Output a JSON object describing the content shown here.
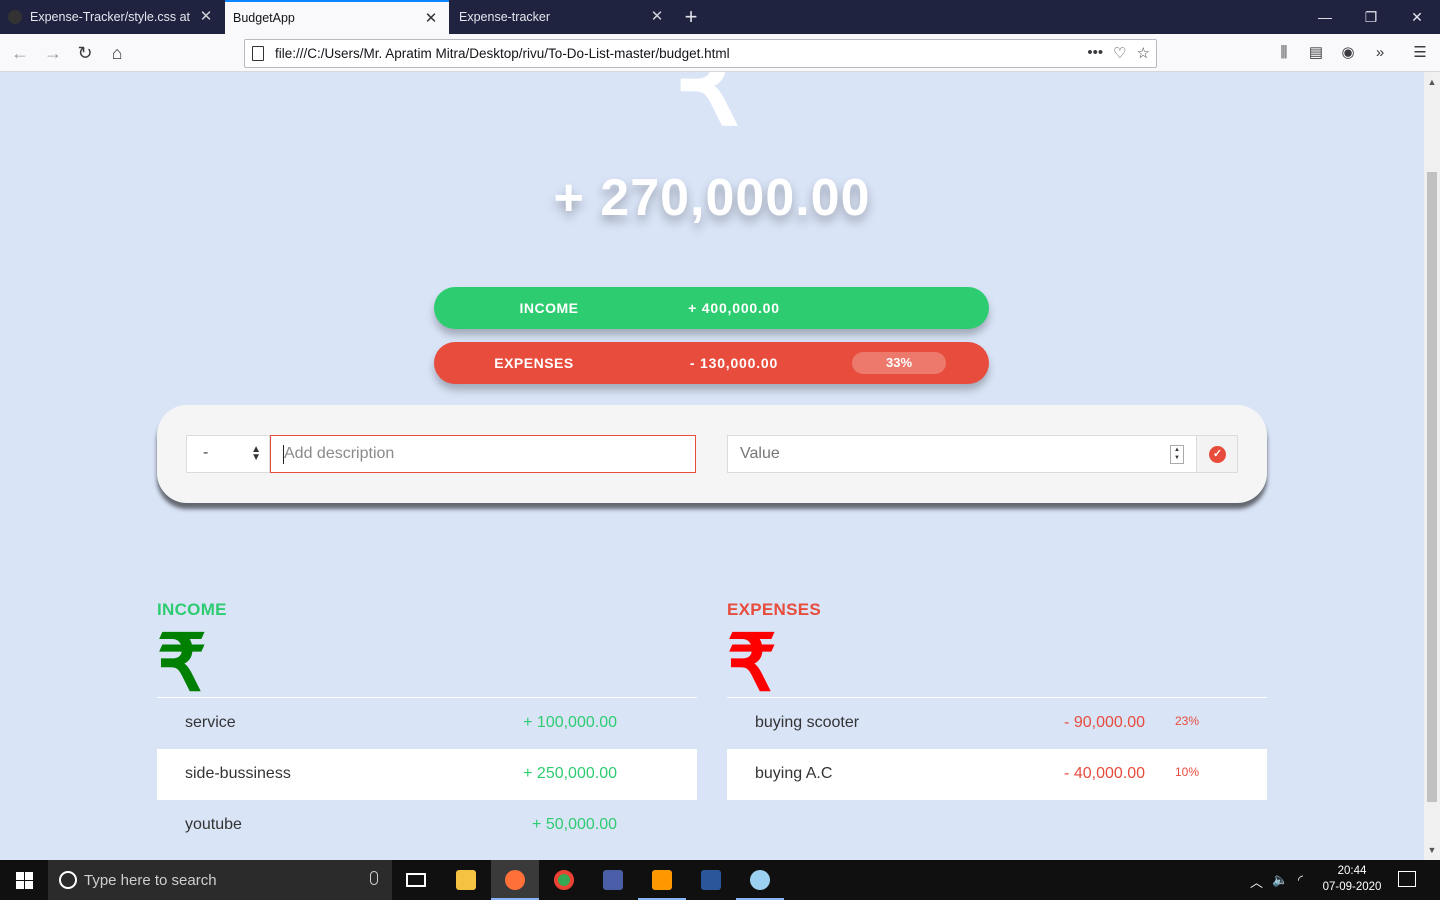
{
  "browser": {
    "tabs": [
      {
        "label": "Expense-Tracker/style.css at master",
        "active": false
      },
      {
        "label": "BudgetApp",
        "active": true
      },
      {
        "label": "Expense-tracker",
        "active": false
      }
    ],
    "url": "file:///C:/Users/Mr. Apratim Mitra/Desktop/rivu/To-Do-List-master/budget.html"
  },
  "budget": {
    "available": "+ 270,000.00",
    "income_label": "INCOME",
    "income_value": "+ 400,000.00",
    "expenses_label": "EXPENSES",
    "expenses_value": "- 130,000.00",
    "expenses_percentage": "33%"
  },
  "add_form": {
    "type_value": "-",
    "description_placeholder": "Add description",
    "value_placeholder": "Value"
  },
  "income": {
    "title": "INCOME",
    "symbol": "₹",
    "items": [
      {
        "description": "service",
        "value": "+ 100,000.00"
      },
      {
        "description": "side-bussiness",
        "value": "+ 250,000.00"
      },
      {
        "description": "youtube",
        "value": "+ 50,000.00"
      }
    ]
  },
  "expenses": {
    "title": "EXPENSES",
    "symbol": "₹",
    "items": [
      {
        "description": "buying scooter",
        "value": "- 90,000.00",
        "percentage": "23%"
      },
      {
        "description": "buying A.C",
        "value": "- 40,000.00",
        "percentage": "10%"
      }
    ]
  },
  "hero_symbol": "₹",
  "taskbar": {
    "search_placeholder": "Type here to search",
    "time": "20:44",
    "date": "07-09-2020"
  },
  "colors": {
    "income": "#2ecc71",
    "expense": "#e74c3c",
    "page_background": "#d9e4f7",
    "income_symbol": "#008000",
    "expense_symbol": "#ff0000"
  }
}
